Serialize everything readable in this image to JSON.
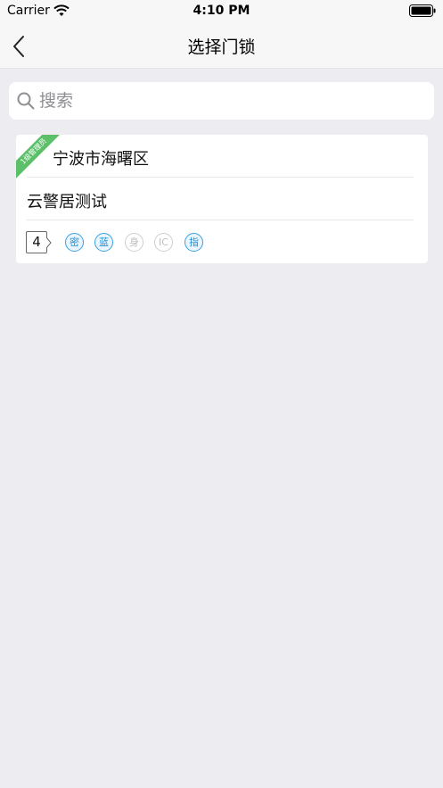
{
  "status_bar": {
    "carrier": "Carrier",
    "time": "4:10 PM",
    "icons": [
      "wifi-icon",
      "battery-icon"
    ]
  },
  "nav": {
    "title": "选择门锁",
    "back_icon": "chevron-left-icon"
  },
  "search": {
    "placeholder": "搜索",
    "value": "",
    "icon": "search-icon"
  },
  "lock_card": {
    "ribbon_label": "1级管理员",
    "address": "宁波市海曙区",
    "name": "云警居测试",
    "count": "4",
    "features": [
      {
        "label": "密",
        "active": true
      },
      {
        "label": "蓝",
        "active": true
      },
      {
        "label": "身",
        "active": false
      },
      {
        "label": "IC",
        "active": false
      },
      {
        "label": "指",
        "active": true
      }
    ]
  },
  "colors": {
    "background": "#ececf1",
    "ribbon": "#5cc06a",
    "feature_active": "#1c8fd8",
    "feature_inactive": "#bdbdbd"
  }
}
